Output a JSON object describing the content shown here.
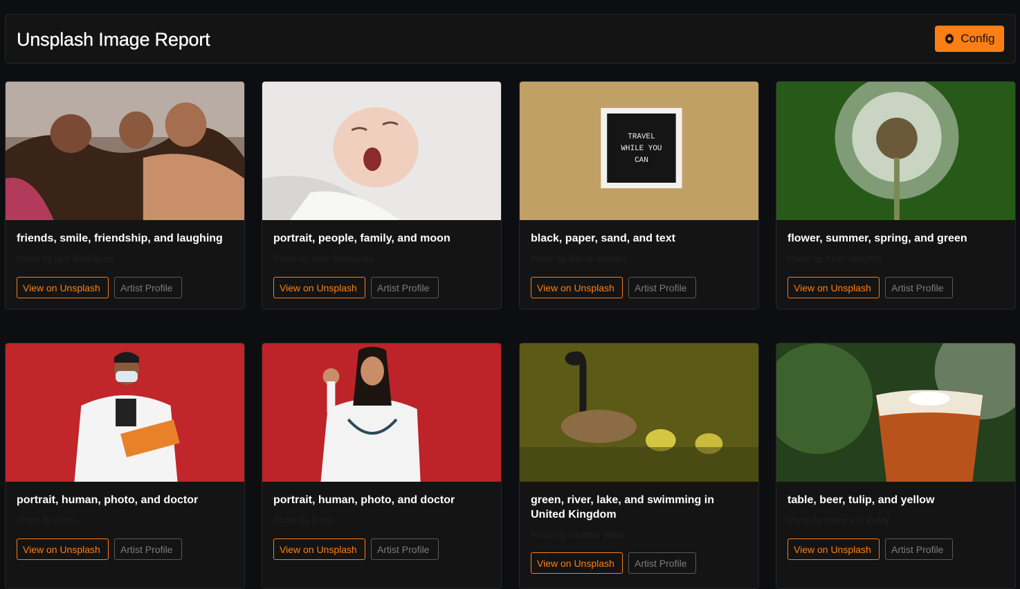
{
  "header": {
    "title": "Unsplash Image Report",
    "config_label": "Config"
  },
  "cards": [
    {
      "tags": "friends, smile, friendship, and laughing",
      "credit": "Photo by Igor Rodrigues",
      "view_label": "View on Unsplash",
      "artist_label": "Artist Profile"
    },
    {
      "tags": "portrait, people, family, and moon",
      "credit": "Photo by Jose Rodrigues",
      "view_label": "View on Unsplash",
      "artist_label": "Artist Profile"
    },
    {
      "tags": "black, paper, sand, and text",
      "credit": "Photo by Rohan Ahmed",
      "view_label": "View on Unsplash",
      "artist_label": "Artist Profile",
      "image_text": [
        "TRAVEL",
        "WHILE YOU",
        "CAN"
      ]
    },
    {
      "tags": "flower, summer, spring, and green",
      "credit": "Photo by Keith McCrory",
      "view_label": "View on Unsplash",
      "artist_label": "Artist Profile"
    },
    {
      "tags": "portrait, human, photo, and doctor",
      "credit": "Photo by Fotos",
      "view_label": "View on Unsplash",
      "artist_label": "Artist Profile"
    },
    {
      "tags": "portrait, human, photo, and doctor",
      "credit": "Photo by Fotos",
      "view_label": "View on Unsplash",
      "artist_label": "Artist Profile"
    },
    {
      "tags": "green, river, lake, and swimming in United Kingdom",
      "credit": "Photo by Heather Wilde",
      "view_label": "View on Unsplash",
      "artist_label": "Artist Profile"
    },
    {
      "tags": "table, beer, tulip, and yellow",
      "credit": "Photo by monica di loxley",
      "view_label": "View on Unsplash",
      "artist_label": "Artist Profile"
    }
  ],
  "colors": {
    "accent": "#fd7e14",
    "background": "#0c0e12",
    "card": "#141414",
    "border": "#262626"
  }
}
